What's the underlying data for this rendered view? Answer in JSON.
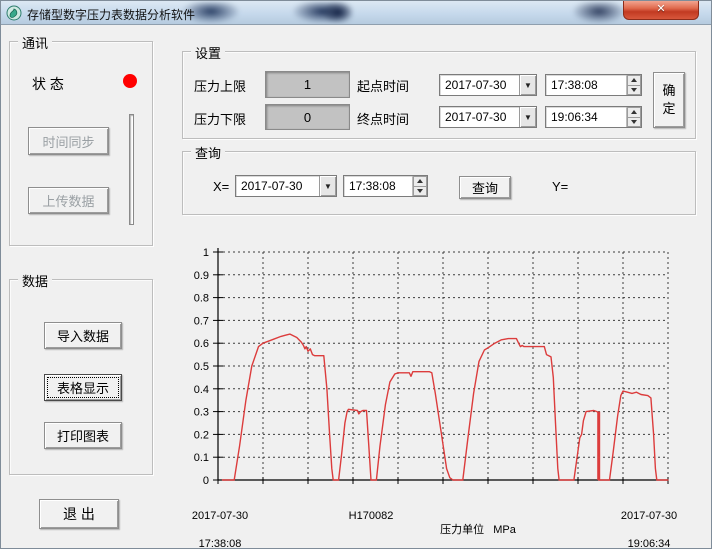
{
  "window": {
    "title": "存储型数字压力表数据分析软件"
  },
  "icons": {
    "close": "✕",
    "dropdown": "▼",
    "status_color": "#ff0000"
  },
  "comm_group": {
    "title": "通讯",
    "status_label": "状 态",
    "sync_button": "时间同步",
    "upload_button": "上传数据"
  },
  "settings_group": {
    "title": "设置",
    "upper_label": "压力上限",
    "upper_value": "1",
    "lower_label": "压力下限",
    "lower_value": "0",
    "start_label": "起点时间",
    "start_date": "2017-07-30",
    "start_time": "17:38:08",
    "end_label": "终点时间",
    "end_date": "2017-07-30",
    "end_time": "19:06:34",
    "ok_button": "确定"
  },
  "query_group": {
    "title": "查询",
    "x_label": "X=",
    "date": "2017-07-30",
    "time": "17:38:08",
    "query_button": "查询",
    "y_label": "Y="
  },
  "data_group": {
    "title": "数据",
    "import_button": "导入数据",
    "table_button": "表格显示",
    "print_button": "打印图表"
  },
  "exit_button": "退 出",
  "chart_data": {
    "type": "line",
    "title": "",
    "xlabel": "",
    "ylabel": "",
    "ylim": [
      0,
      1
    ],
    "y_tick_step": 0.1,
    "x_divisions": 10,
    "grid": true,
    "line_color": "#dc3c3c",
    "axis_color": "#000000",
    "grid_color": "#3c3c3c",
    "x_range_labels": [
      "2017-07-30 17:38:08",
      "2017-07-30 19:06:34"
    ],
    "footer": {
      "start_date": "2017-07-30",
      "start_time": "17:38:08",
      "device_id": "H170082",
      "unit_label": "压力单位",
      "unit": "MPa",
      "end_date": "2017-07-30",
      "end_time": "19:06:34"
    },
    "points": [
      [
        0.01,
        0
      ],
      [
        0.036,
        0
      ],
      [
        0.048,
        0.15
      ],
      [
        0.062,
        0.35
      ],
      [
        0.075,
        0.5
      ],
      [
        0.09,
        0.585
      ],
      [
        0.1,
        0.6
      ],
      [
        0.12,
        0.615
      ],
      [
        0.14,
        0.63
      ],
      [
        0.15,
        0.635
      ],
      [
        0.16,
        0.64
      ],
      [
        0.175,
        0.625
      ],
      [
        0.185,
        0.605
      ],
      [
        0.19,
        0.59
      ],
      [
        0.193,
        0.575
      ],
      [
        0.196,
        0.585
      ],
      [
        0.2,
        0.565
      ],
      [
        0.205,
        0.575
      ],
      [
        0.21,
        0.55
      ],
      [
        0.215,
        0.545
      ],
      [
        0.235,
        0.545
      ],
      [
        0.242,
        0.4
      ],
      [
        0.248,
        0.2
      ],
      [
        0.253,
        0.05
      ],
      [
        0.256,
        0
      ],
      [
        0.268,
        0
      ],
      [
        0.275,
        0.12
      ],
      [
        0.282,
        0.25
      ],
      [
        0.287,
        0.3
      ],
      [
        0.29,
        0.31
      ],
      [
        0.31,
        0.305
      ],
      [
        0.313,
        0.29
      ],
      [
        0.317,
        0.3
      ],
      [
        0.322,
        0.305
      ],
      [
        0.33,
        0.305
      ],
      [
        0.335,
        0.15
      ],
      [
        0.34,
        0
      ],
      [
        0.352,
        0
      ],
      [
        0.36,
        0.15
      ],
      [
        0.372,
        0.33
      ],
      [
        0.382,
        0.43
      ],
      [
        0.393,
        0.465
      ],
      [
        0.4,
        0.47
      ],
      [
        0.425,
        0.47
      ],
      [
        0.429,
        0.455
      ],
      [
        0.433,
        0.475
      ],
      [
        0.47,
        0.475
      ],
      [
        0.475,
        0.47
      ],
      [
        0.483,
        0.38
      ],
      [
        0.495,
        0.22
      ],
      [
        0.508,
        0.05
      ],
      [
        0.515,
        0.01
      ],
      [
        0.522,
        0
      ],
      [
        0.544,
        0
      ],
      [
        0.555,
        0.18
      ],
      [
        0.568,
        0.38
      ],
      [
        0.58,
        0.52
      ],
      [
        0.592,
        0.57
      ],
      [
        0.6,
        0.58
      ],
      [
        0.615,
        0.6
      ],
      [
        0.63,
        0.615
      ],
      [
        0.645,
        0.62
      ],
      [
        0.663,
        0.62
      ],
      [
        0.668,
        0.6
      ],
      [
        0.672,
        0.585
      ],
      [
        0.676,
        0.59
      ],
      [
        0.68,
        0.585
      ],
      [
        0.725,
        0.585
      ],
      [
        0.73,
        0.55
      ],
      [
        0.735,
        0.545
      ],
      [
        0.74,
        0.54
      ],
      [
        0.745,
        0.45
      ],
      [
        0.75,
        0.25
      ],
      [
        0.755,
        0.05
      ],
      [
        0.758,
        0
      ],
      [
        0.791,
        0
      ],
      [
        0.798,
        0.1
      ],
      [
        0.804,
        0.185
      ],
      [
        0.808,
        0.2
      ],
      [
        0.812,
        0.26
      ],
      [
        0.818,
        0.3
      ],
      [
        0.835,
        0.305
      ],
      [
        0.842,
        0.3
      ],
      [
        0.845,
        0.295
      ],
      [
        0.846,
        0
      ],
      [
        0.87,
        0
      ],
      [
        0.878,
        0.12
      ],
      [
        0.888,
        0.28
      ],
      [
        0.895,
        0.37
      ],
      [
        0.9,
        0.39
      ],
      [
        0.91,
        0.385
      ],
      [
        0.92,
        0.38
      ],
      [
        0.93,
        0.385
      ],
      [
        0.94,
        0.375
      ],
      [
        0.955,
        0.37
      ],
      [
        0.962,
        0.36
      ],
      [
        0.968,
        0.2
      ],
      [
        0.972,
        0.05
      ],
      [
        0.975,
        0
      ],
      [
        1.0,
        0
      ]
    ],
    "thick_drop": {
      "t": 0.846,
      "y_from": 0.3,
      "y_to": 0
    }
  }
}
